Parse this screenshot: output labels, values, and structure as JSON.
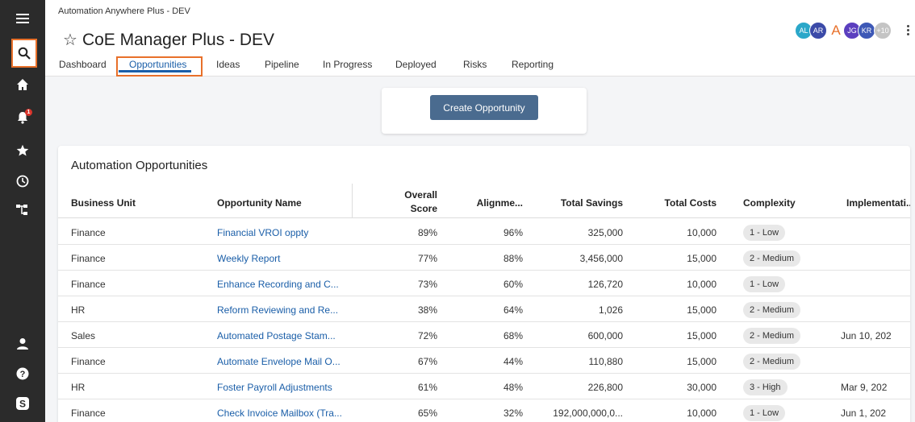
{
  "app": {
    "subtitle": "Automation Anywhere Plus - DEV",
    "title": "CoE Manager Plus - DEV"
  },
  "tabs": [
    {
      "label": "Dashboard"
    },
    {
      "label": "Opportunities",
      "active": true
    },
    {
      "label": "Ideas"
    },
    {
      "label": "Pipeline"
    },
    {
      "label": "In Progress"
    },
    {
      "label": "Deployed"
    },
    {
      "label": "Risks"
    },
    {
      "label": "Reporting"
    }
  ],
  "avatars": [
    {
      "initials": "AL",
      "color": "#2aa7c9"
    },
    {
      "initials": "AR",
      "color": "#3b4aa8"
    },
    {
      "initials": "A",
      "color": "#e8702a"
    },
    {
      "initials": "JG",
      "color": "#5b3fbf"
    },
    {
      "initials": "KR",
      "color": "#3d58b6"
    },
    {
      "initials": "+10",
      "color": "#c4c4c4"
    }
  ],
  "sidebar": {
    "badge_count": "1",
    "icons": [
      "menu-icon",
      "search-icon",
      "home-icon",
      "bell-icon",
      "star-icon",
      "clock-icon",
      "hierarchy-icon",
      "user-icon",
      "help-icon",
      "brand-icon"
    ]
  },
  "create_button": "Create Opportunity",
  "table": {
    "title": "Automation Opportunities",
    "columns": {
      "business_unit": "Business Unit",
      "opportunity_name": "Opportunity Name",
      "overall_score_1": "Overall",
      "overall_score_2": "Score",
      "alignment": "Alignme...",
      "total_savings": "Total Savings",
      "total_costs": "Total Costs",
      "complexity": "Complexity",
      "implementation": "Implementati..."
    },
    "rows": [
      {
        "bu": "Finance",
        "name": "Financial VROI oppty",
        "score": "89%",
        "align": "96%",
        "savings": "325,000",
        "costs": "10,000",
        "complexity": "1 - Low",
        "impl": ""
      },
      {
        "bu": "Finance",
        "name": "Weekly Report",
        "score": "77%",
        "align": "88%",
        "savings": "3,456,000",
        "costs": "15,000",
        "complexity": "2 - Medium",
        "impl": ""
      },
      {
        "bu": "Finance",
        "name": "Enhance Recording and C...",
        "score": "73%",
        "align": "60%",
        "savings": "126,720",
        "costs": "10,000",
        "complexity": "1 - Low",
        "impl": ""
      },
      {
        "bu": "HR",
        "name": "Reform Reviewing and Re...",
        "score": "38%",
        "align": "64%",
        "savings": "1,026",
        "costs": "15,000",
        "complexity": "2 - Medium",
        "impl": ""
      },
      {
        "bu": "Sales",
        "name": "Automated Postage Stam...",
        "score": "72%",
        "align": "68%",
        "savings": "600,000",
        "costs": "15,000",
        "complexity": "2 - Medium",
        "impl": "Jun 10, 202"
      },
      {
        "bu": "Finance",
        "name": "Automate Envelope Mail O...",
        "score": "67%",
        "align": "44%",
        "savings": "110,880",
        "costs": "15,000",
        "complexity": "2 - Medium",
        "impl": ""
      },
      {
        "bu": "HR",
        "name": "Foster Payroll Adjustments",
        "score": "61%",
        "align": "48%",
        "savings": "226,800",
        "costs": "30,000",
        "complexity": "3 - High",
        "impl": "Mar 9, 202"
      },
      {
        "bu": "Finance",
        "name": "Check Invoice Mailbox (Tra...",
        "score": "65%",
        "align": "32%",
        "savings": "192,000,000,0...",
        "costs": "10,000",
        "complexity": "1 - Low",
        "impl": "Jun 1, 202"
      }
    ]
  }
}
